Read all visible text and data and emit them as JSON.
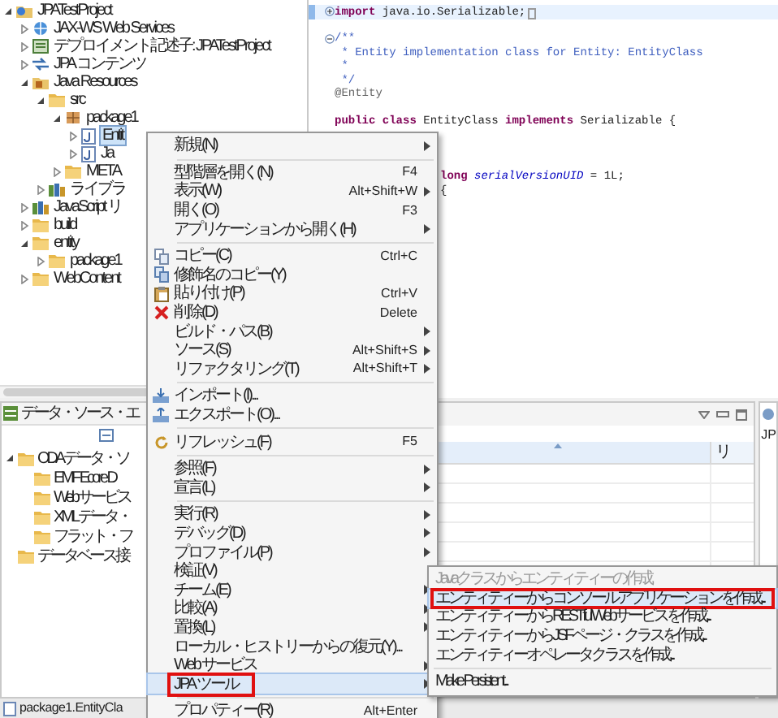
{
  "project_tree": [
    {
      "label": "JPATestProject",
      "kind": "project",
      "expanded": true,
      "selected": false,
      "children": [
        {
          "label": "JAX-WS Web Services",
          "kind": "webservice",
          "expanded": false,
          "selected": false
        },
        {
          "label": "デプロイメント記述子: JPATestProject",
          "kind": "descriptor",
          "expanded": false,
          "selected": false
        },
        {
          "label": "JPA コンテンツ",
          "kind": "jpa",
          "expanded": false,
          "selected": false
        },
        {
          "label": "Java Resources",
          "kind": "java-resources",
          "expanded": true,
          "selected": false,
          "children": [
            {
              "label": "src",
              "kind": "source-folder",
              "expanded": true,
              "selected": false,
              "children": [
                {
                  "label": "package1",
                  "kind": "package",
                  "expanded": true,
                  "selected": false,
                  "children": [
                    {
                      "label": "Entit",
                      "kind": "java-file",
                      "expanded": false,
                      "selected": true
                    },
                    {
                      "label": "Ja",
                      "kind": "java-file",
                      "expanded": false,
                      "selected": false
                    }
                  ]
                },
                {
                  "label": "META",
                  "kind": "folder",
                  "expanded": false,
                  "selected": false
                }
              ]
            },
            {
              "label": "ライブラ",
              "kind": "library",
              "expanded": false,
              "selected": false
            }
          ]
        },
        {
          "label": "JavaScript リ",
          "kind": "library",
          "expanded": false,
          "selected": false
        },
        {
          "label": "build",
          "kind": "folder",
          "expanded": false,
          "selected": false
        },
        {
          "label": "entity",
          "kind": "folder",
          "expanded": true,
          "selected": false,
          "children": [
            {
              "label": "package1",
              "kind": "folder",
              "expanded": false,
              "selected": false
            }
          ]
        },
        {
          "label": "WebContent",
          "kind": "folder",
          "expanded": false,
          "selected": false
        }
      ]
    }
  ],
  "editor": {
    "lines": [
      {
        "kind": "code",
        "collapsed": true,
        "current": true,
        "blank_before": false,
        "segments": [
          {
            "kind": "keyword",
            "text": "import"
          },
          {
            "kind": "plain",
            "text": " java.io.Serializable;"
          }
        ]
      },
      {
        "kind": "code",
        "collapsed": false,
        "current": false,
        "blank_before": true,
        "segments": [
          {
            "kind": "comment",
            "text": "/**"
          }
        ]
      },
      {
        "kind": "code",
        "current": false,
        "blank_before": false,
        "segments": [
          {
            "kind": "comment",
            "text": " * Entity implementation class for Entity: EntityClass"
          }
        ]
      },
      {
        "kind": "code",
        "current": false,
        "blank_before": false,
        "segments": [
          {
            "kind": "comment",
            "text": " *"
          }
        ]
      },
      {
        "kind": "code",
        "current": false,
        "blank_before": false,
        "segments": [
          {
            "kind": "comment",
            "text": " */"
          }
        ]
      },
      {
        "kind": "code",
        "current": false,
        "blank_before": false,
        "segments": [
          {
            "kind": "annotation",
            "text": "@Entity"
          }
        ]
      },
      {
        "kind": "code",
        "current": false,
        "blank_before": true,
        "segments": [
          {
            "kind": "keyword",
            "text": "public class"
          },
          {
            "kind": "plain",
            "text": " EntityClass "
          },
          {
            "kind": "keyword",
            "text": "implements"
          },
          {
            "kind": "plain",
            "text": " Serializable {"
          }
        ]
      },
      {
        "kind": "partial",
        "current": false,
        "blank_before": true,
        "segments": [
          {
            "kind": "keyword",
            "text": "long "
          },
          {
            "kind": "field",
            "text": "serialVersionUID"
          },
          {
            "kind": "plain",
            "text": " = 1L;"
          }
        ]
      },
      {
        "kind": "partial",
        "current": false,
        "blank_before": false,
        "segments": [
          {
            "kind": "plain",
            "text": "{"
          }
        ]
      }
    ]
  },
  "data_source_view": {
    "tab": "データ・ソース・エ",
    "tree": [
      {
        "label": "ODA データ・ソ",
        "expanded": true,
        "children": [
          {
            "label": "EMF Ecore D"
          },
          {
            "label": "Web サービス"
          },
          {
            "label": "XML データ・"
          },
          {
            "label": "フラット・フ"
          }
        ]
      },
      {
        "label": "データベース接"
      }
    ]
  },
  "table_view": {
    "columns": [
      {
        "sorted": true
      },
      {
        "label": "リ"
      }
    ]
  },
  "side_view": {
    "label": "JP"
  },
  "status_bar": {
    "text": "package1.EntityCla"
  },
  "context_menu": {
    "items": [
      {
        "kind": "plain",
        "label": "新規(N)",
        "submenu": true,
        "selected": false
      },
      {
        "kind": "separator"
      },
      {
        "kind": "plain",
        "label": "型階層を開く(N)",
        "shortcut": "F4",
        "submenu": false,
        "selected": false
      },
      {
        "kind": "plain",
        "label": "表示(W)",
        "shortcut": "Alt+Shift+W",
        "submenu": true,
        "selected": false
      },
      {
        "kind": "plain",
        "label": "開く(O)",
        "shortcut": "F3",
        "submenu": false,
        "selected": false
      },
      {
        "kind": "plain",
        "label": "アプリケーションから開く(H)",
        "submenu": true,
        "selected": false
      },
      {
        "kind": "separator"
      },
      {
        "kind": "copy",
        "label": "コピー(C)",
        "shortcut": "Ctrl+C",
        "submenu": false,
        "selected": false
      },
      {
        "kind": "qualified-copy",
        "label": "修飾名のコピー(Y)",
        "submenu": false,
        "selected": false
      },
      {
        "kind": "paste",
        "label": "貼り付け(P)",
        "shortcut": "Ctrl+V",
        "submenu": false,
        "selected": false
      },
      {
        "kind": "delete",
        "label": "削除(D)",
        "shortcut": "Delete",
        "submenu": false,
        "selected": false
      },
      {
        "kind": "plain",
        "label": "ビルド・パス(B)",
        "submenu": true,
        "selected": false
      },
      {
        "kind": "plain",
        "label": "ソース(S)",
        "shortcut": "Alt+Shift+S",
        "submenu": true,
        "selected": false
      },
      {
        "kind": "plain",
        "label": "リファクタリング(T)",
        "shortcut": "Alt+Shift+T",
        "submenu": true,
        "selected": false
      },
      {
        "kind": "separator"
      },
      {
        "kind": "import",
        "label": "インポート(I)...",
        "submenu": false,
        "selected": false
      },
      {
        "kind": "export",
        "label": "エクスポート(O)...",
        "submenu": false,
        "selected": false
      },
      {
        "kind": "separator"
      },
      {
        "kind": "refresh",
        "label": "リフレッシュ(F)",
        "shortcut": "F5",
        "submenu": false,
        "selected": false
      },
      {
        "kind": "separator"
      },
      {
        "kind": "plain",
        "label": "参照(F)",
        "submenu": true,
        "selected": false
      },
      {
        "kind": "plain",
        "label": "宣言(L)",
        "submenu": true,
        "selected": false
      },
      {
        "kind": "separator"
      },
      {
        "kind": "plain",
        "label": "実行(R)",
        "submenu": true,
        "selected": false
      },
      {
        "kind": "plain",
        "label": "デバッグ(D)",
        "submenu": true,
        "selected": false
      },
      {
        "kind": "plain",
        "label": "プロファイル(P)",
        "submenu": true,
        "selected": false
      },
      {
        "kind": "plain",
        "label": "検証(V)",
        "submenu": false,
        "selected": false
      },
      {
        "kind": "plain",
        "label": "チーム(E)",
        "submenu": true,
        "selected": false
      },
      {
        "kind": "plain",
        "label": "比較(A)",
        "submenu": true,
        "selected": false
      },
      {
        "kind": "plain",
        "label": "置換(L)",
        "submenu": true,
        "selected": false
      },
      {
        "kind": "plain",
        "label": "ローカル・ヒストリーからの復元(Y)...",
        "submenu": false,
        "selected": false
      },
      {
        "kind": "plain",
        "label": "Web サービス",
        "submenu": true,
        "selected": false
      },
      {
        "kind": "plain",
        "label": "JPA ツール",
        "submenu": true,
        "selected": true,
        "annotated": true
      },
      {
        "kind": "separator"
      },
      {
        "kind": "plain",
        "label": "プロパティー(R)",
        "shortcut": "Alt+Enter",
        "submenu": false,
        "selected": false
      }
    ]
  },
  "submenu": {
    "items": [
      {
        "kind": "item",
        "label": "Javaクラスからエンティティーの作成",
        "disabled": true,
        "selected": false,
        "annotated": false
      },
      {
        "kind": "item",
        "label": "エンティティーからコンソールアプリケーションを作成...",
        "disabled": false,
        "selected": true,
        "annotated": true
      },
      {
        "kind": "item",
        "label": "エンティティーからRESTful Webサービスを作成...",
        "disabled": false,
        "selected": false,
        "annotated": false
      },
      {
        "kind": "item",
        "label": "エンティティーからJSFページ・クラスを作成...",
        "disabled": false,
        "selected": false,
        "annotated": false
      },
      {
        "kind": "item",
        "label": "エンティティーオペレータクラスを作成...",
        "disabled": false,
        "selected": false,
        "annotated": false
      },
      {
        "kind": "separator"
      },
      {
        "kind": "item",
        "label": "Make Persistent...",
        "disabled": false,
        "selected": false,
        "annotated": false
      }
    ]
  }
}
